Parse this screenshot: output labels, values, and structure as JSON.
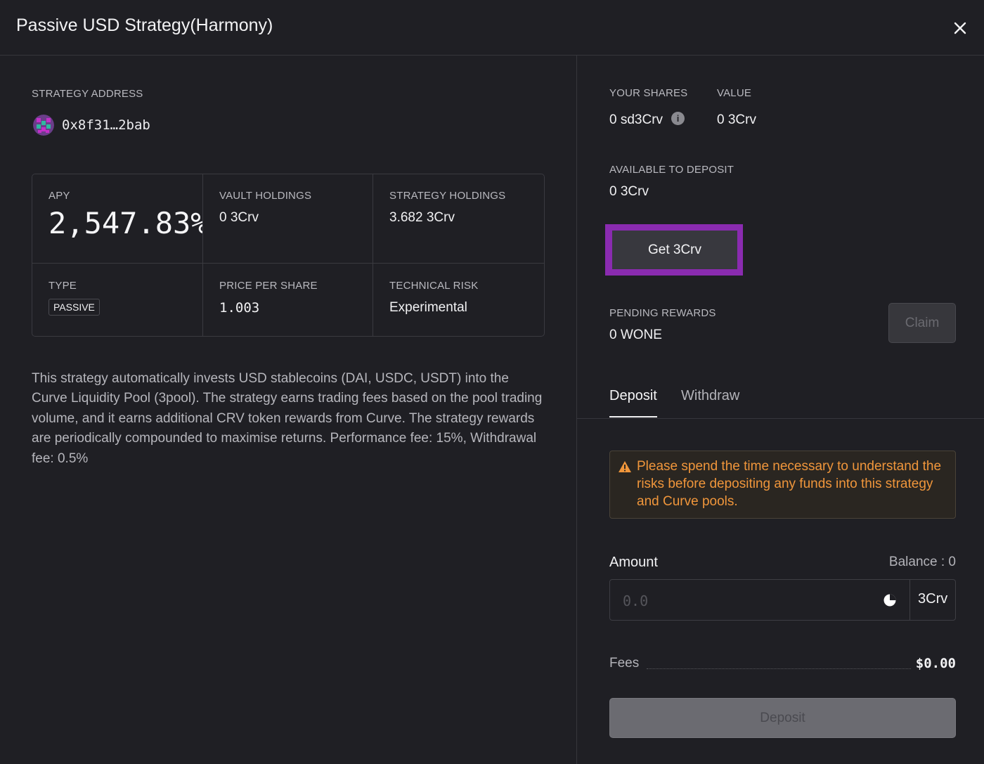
{
  "header": {
    "title": "Passive USD Strategy(Harmony)"
  },
  "strategy": {
    "address_label": "STRATEGY ADDRESS",
    "address": "0x8f31…2bab"
  },
  "stats": {
    "apy_label": "APY",
    "apy_value": "2,547.83%",
    "vault_label": "VAULT HOLDINGS",
    "vault_value": "0 3Crv",
    "strategy_label": "STRATEGY HOLDINGS",
    "strategy_value": "3.682 3Crv",
    "type_label": "TYPE",
    "type_value": "PASSIVE",
    "pps_label": "PRICE PER SHARE",
    "pps_value": "1.003",
    "risk_label": "TECHNICAL RISK",
    "risk_value": "Experimental"
  },
  "description": "This strategy automatically invests USD stablecoins (DAI, USDC, USDT) into the Curve Liquidity Pool (3pool). The strategy earns trading fees based on the pool trading volume, and it earns additional CRV token rewards from Curve. The strategy rewards are periodically compounded to maximise returns. Performance fee: 15%, Withdrawal fee: 0.5%",
  "right": {
    "shares_label": "YOUR SHARES",
    "shares_value": "0 sd3Crv",
    "value_label": "VALUE",
    "value_value": "0 3Crv",
    "available_label": "AVAILABLE TO DEPOSIT",
    "available_value": "0 3Crv",
    "get_button": "Get 3Crv",
    "pending_label": "PENDING REWARDS",
    "pending_value": "0 WONE",
    "claim_button": "Claim"
  },
  "tabs": {
    "deposit": "Deposit",
    "withdraw": "Withdraw"
  },
  "warning": "Please spend the time necessary to understand the risks before depositing any funds into this strategy and Curve pools.",
  "form": {
    "amount_label": "Amount",
    "balance_label": "Balance : 0",
    "amount_placeholder": "0.0",
    "unit": "3Crv",
    "fees_label": "Fees",
    "fees_value": "$0.00",
    "deposit_button": "Deposit"
  },
  "colors": {
    "highlight": "#8a2bb0",
    "warning": "#f0963b",
    "background": "#1f1f24"
  }
}
